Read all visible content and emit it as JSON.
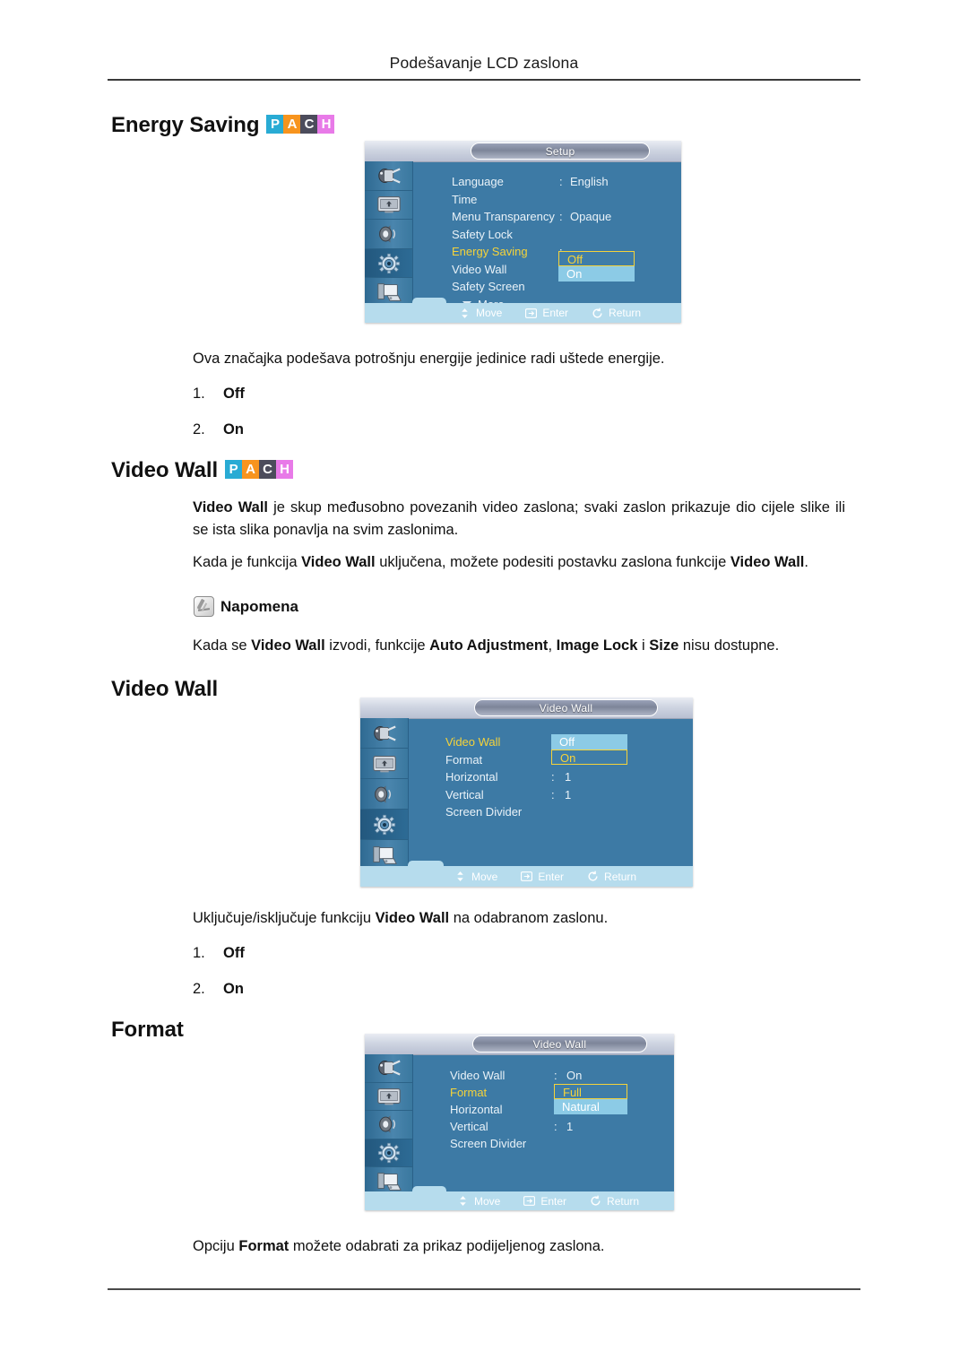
{
  "page": {
    "running_header": "Podešavanje LCD zaslona"
  },
  "badges": {
    "items": [
      {
        "letter": "P",
        "color": "#29abd4"
      },
      {
        "letter": "A",
        "color": "#f7941e"
      },
      {
        "letter": "C",
        "color": "#4c4c5c"
      },
      {
        "letter": "H",
        "color": "#e87ae8"
      }
    ]
  },
  "sections": {
    "energy_saving": {
      "heading": "Energy Saving",
      "description": "Ova značajka podešava potrošnju energije jedinice radi uštede energije.",
      "options": [
        {
          "num": "1.",
          "label": "Off"
        },
        {
          "num": "2.",
          "label": "On"
        }
      ]
    },
    "video_wall_intro": {
      "heading": "Video Wall",
      "para1_pre": "",
      "para1_bold": "Video Wall",
      "para1_post": " je skup međusobno povezanih video zaslona; svaki zaslon prikazuje dio cijele slike ili se ista slika ponavlja na svim zaslonima.",
      "para2": "Kada je funkcija Video Wall uključena, možete podesiti postavku zaslona funkcije Video Wall.",
      "note_label": "Napomena",
      "note_text": "Kada se Video Wall izvodi, funkcije Auto Adjustment, Image Lock i Size nisu dostupne."
    },
    "video_wall": {
      "heading": "Video Wall",
      "description": "Uključuje/isključuje funkciju Video Wall na odabranom zaslonu.",
      "options": [
        {
          "num": "1.",
          "label": "Off"
        },
        {
          "num": "2.",
          "label": "On"
        }
      ]
    },
    "format": {
      "heading": "Format",
      "description": "Opciju Format možete odabrati za prikaz podijeljenog zaslona."
    }
  },
  "osd_setup": {
    "title": "Setup",
    "rows": [
      {
        "label": "Language",
        "colon": ":",
        "value": "English"
      },
      {
        "label": "Time",
        "colon": "",
        "value": ""
      },
      {
        "label": "Menu Transparency",
        "colon": ":",
        "value": "Opaque"
      },
      {
        "label": "Safety Lock",
        "colon": "",
        "value": ""
      },
      {
        "label": "Energy Saving",
        "colon": ":",
        "value": "",
        "selected": true
      },
      {
        "label": "Video Wall",
        "colon": "",
        "value": ""
      },
      {
        "label": "Safety Screen",
        "colon": "",
        "value": ""
      }
    ],
    "more_label": "More",
    "dropdown": [
      {
        "label": "Off",
        "state": "focus"
      },
      {
        "label": "On",
        "state": "highlight"
      }
    ],
    "footer": [
      {
        "icon": "updown-arrow-icon",
        "label": "Move"
      },
      {
        "icon": "enter-icon",
        "label": "Enter"
      },
      {
        "icon": "return-icon",
        "label": "Return"
      }
    ],
    "sidebar_icons": [
      "input-plug-icon",
      "picture-screen-icon",
      "sound-speaker-icon",
      "setup-gear-icon",
      "multi-display-icon"
    ],
    "active_sidebar_index": 3
  },
  "osd_video_wall": {
    "title": "Video Wall",
    "rows": [
      {
        "label": "Video Wall",
        "colon": ":",
        "value": "",
        "selected": true
      },
      {
        "label": "Format",
        "colon": ":",
        "value": ""
      },
      {
        "label": "Horizontal",
        "colon": ":",
        "value": "1"
      },
      {
        "label": "Vertical",
        "colon": ":",
        "value": "1"
      },
      {
        "label": "Screen Divider",
        "colon": "",
        "value": ""
      }
    ],
    "dropdown": [
      {
        "label": "Off",
        "state": "highlight"
      },
      {
        "label": "On",
        "state": "focus"
      }
    ],
    "footer": [
      {
        "icon": "updown-arrow-icon",
        "label": "Move"
      },
      {
        "icon": "enter-icon",
        "label": "Enter"
      },
      {
        "icon": "return-icon",
        "label": "Return"
      }
    ],
    "sidebar_icons": [
      "input-plug-icon",
      "picture-screen-icon",
      "sound-speaker-icon",
      "setup-gear-icon",
      "multi-display-icon"
    ],
    "active_sidebar_index": 3
  },
  "osd_format": {
    "title": "Video Wall",
    "rows": [
      {
        "label": "Video Wall",
        "colon": ":",
        "value": "On"
      },
      {
        "label": "Format",
        "colon": ":",
        "value": "",
        "selected": true
      },
      {
        "label": "Horizontal",
        "colon": ":",
        "value": ""
      },
      {
        "label": "Vertical",
        "colon": ":",
        "value": "1"
      },
      {
        "label": "Screen Divider",
        "colon": "",
        "value": ""
      }
    ],
    "dropdown": [
      {
        "label": "Full",
        "state": "focus"
      },
      {
        "label": "Natural",
        "state": "highlight"
      }
    ],
    "footer": [
      {
        "icon": "updown-arrow-icon",
        "label": "Move"
      },
      {
        "icon": "enter-icon",
        "label": "Enter"
      },
      {
        "icon": "return-icon",
        "label": "Return"
      }
    ],
    "sidebar_icons": [
      "input-plug-icon",
      "picture-screen-icon",
      "sound-speaker-icon",
      "setup-gear-icon",
      "multi-display-icon"
    ],
    "active_sidebar_index": 3
  }
}
